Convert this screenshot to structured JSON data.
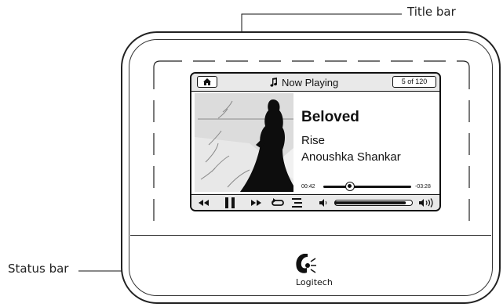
{
  "callouts": {
    "title_bar": "Title bar",
    "status_bar": "Status bar"
  },
  "screen": {
    "title": "Now Playing",
    "track_count": "5 of 120",
    "song_title": "Beloved",
    "album": "Rise",
    "artist": "Anoushka Shankar",
    "time_elapsed": "00:42",
    "time_remaining": "-03:28",
    "progress_fraction": 0.3,
    "volume_fraction": 0.95
  },
  "device": {
    "brand": "Logitech"
  },
  "icons": [
    "home-icon",
    "music-note-icon",
    "rewind-icon",
    "pause-icon",
    "fast-forward-icon",
    "repeat-icon",
    "queue-icon",
    "volume-low-icon",
    "volume-high-icon",
    "logitech-logo"
  ],
  "colors": {
    "bar_fill": "#e9e9e9",
    "line": "#111111"
  }
}
